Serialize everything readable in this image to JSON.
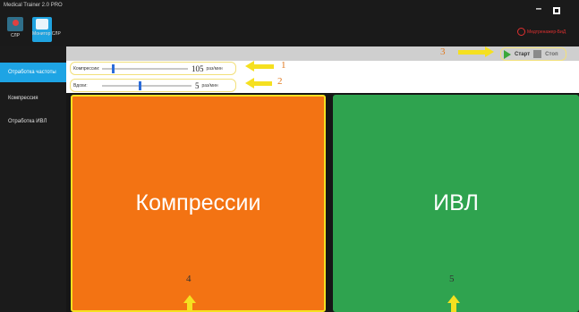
{
  "window": {
    "title": "Medical Trainer 2.0 PRO"
  },
  "toolbar": {
    "apps": [
      {
        "label": "СЛР",
        "icon": "heart-monitor-icon"
      },
      {
        "label": "Монитор СЛР",
        "icon": "monitor-icon"
      }
    ],
    "brand": "Медтренажер-БиД"
  },
  "sidebar": {
    "items": [
      {
        "label": "Отработка частоты",
        "active": true
      },
      {
        "label": "Компрессия",
        "active": false
      },
      {
        "label": "Отработка ИВЛ",
        "active": false
      }
    ]
  },
  "controls": {
    "compression": {
      "label": "Компрессии:",
      "value": "105",
      "unit": "раз/мин",
      "fraction": 0.12
    },
    "breaths": {
      "label": "Вдохи:",
      "value": "5",
      "unit": "раз/мин",
      "fraction": 0.42
    },
    "start_label": "Старт",
    "stop_label": "Стоп"
  },
  "panels": {
    "left": "Компрессии",
    "right": "ИВЛ"
  },
  "callouts": [
    "1",
    "2",
    "3",
    "4",
    "5"
  ],
  "colors": {
    "accent": "#1ea4e4",
    "compression_panel": "#f37313",
    "ventilation_panel": "#2fa34f",
    "highlight": "#f5e020"
  }
}
